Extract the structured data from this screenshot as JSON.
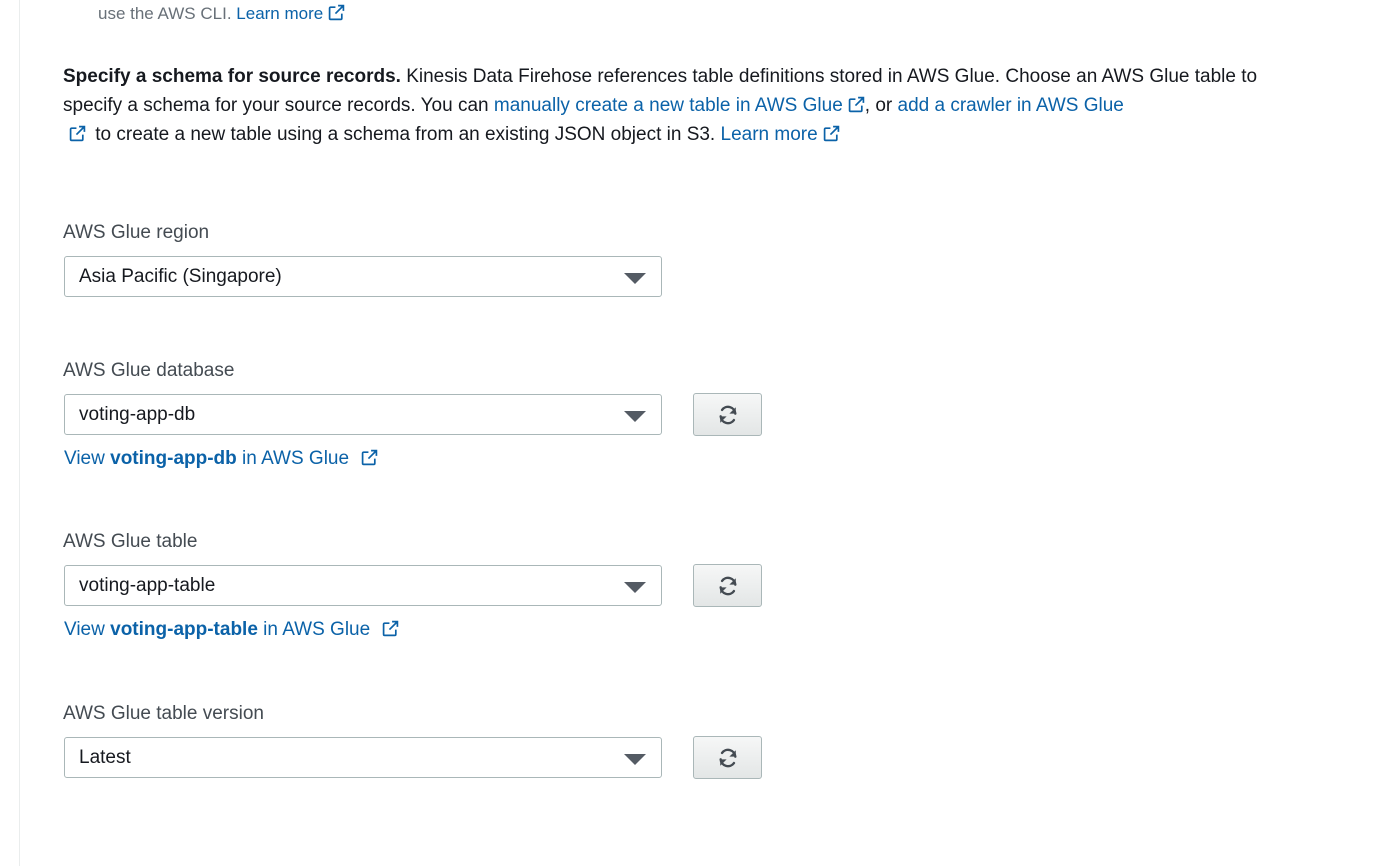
{
  "top_note": {
    "text": "use the AWS CLI.",
    "learn_more": "Learn more"
  },
  "description": {
    "bold_lead": "Specify a schema for source records.",
    "text_1": " Kinesis Data Firehose references table definitions stored in AWS Glue. Choose an AWS Glue table to specify a schema for your source records. You can ",
    "link_1": "manually create a new table in AWS Glue",
    "text_2": ", or ",
    "link_2": "add a crawler in AWS Glue",
    "text_3": " to create a new table using a schema from an existing JSON object in S3. ",
    "learn_more": "Learn more"
  },
  "fields": {
    "region": {
      "label": "AWS Glue region",
      "value": "Asia Pacific (Singapore)"
    },
    "database": {
      "label": "AWS Glue database",
      "value": "voting-app-db",
      "view_prefix": "View ",
      "view_name": "voting-app-db",
      "view_suffix": " in AWS Glue"
    },
    "table": {
      "label": "AWS Glue table",
      "value": "voting-app-table",
      "view_prefix": "View ",
      "view_name": "voting-app-table",
      "view_suffix": " in AWS Glue"
    },
    "table_version": {
      "label": "AWS Glue table version",
      "value": "Latest"
    }
  },
  "icons": {
    "external_link": "external-link-icon",
    "refresh": "refresh-icon",
    "dropdown": "caret-down-icon"
  },
  "colors": {
    "link": "#0b62a8",
    "text": "#16191f",
    "label": "#444b52",
    "muted": "#687078",
    "border": "#aab7b8"
  }
}
